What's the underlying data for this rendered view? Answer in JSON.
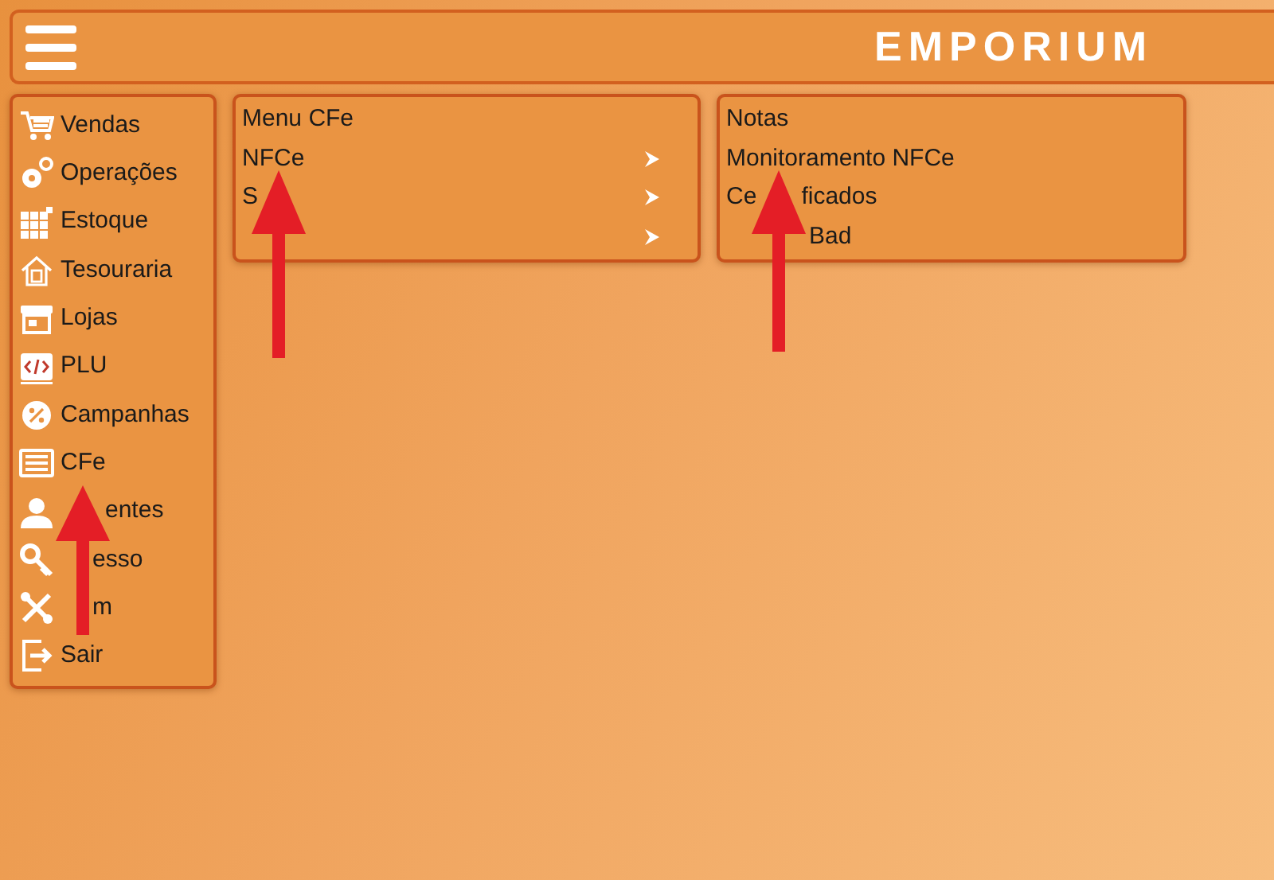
{
  "header": {
    "logo": "EMPORIUM"
  },
  "sidebar": {
    "items": [
      {
        "label": "Vendas",
        "kind": "cart"
      },
      {
        "label": "Operações",
        "kind": "gears"
      },
      {
        "label": "Estoque",
        "kind": "grid"
      },
      {
        "label": "Tesouraria",
        "kind": "house"
      },
      {
        "label": "Lojas",
        "kind": "store"
      },
      {
        "label": "PLU",
        "kind": "code"
      },
      {
        "label": "Campanhas",
        "kind": "percent"
      },
      {
        "label": "CFe",
        "kind": "list"
      },
      {
        "parts": [
          {
            "text": "entes",
            "kind": "wider"
          }
        ],
        "kind": "person"
      },
      {
        "parts": [
          {
            "text": "esso",
            "kind": "short"
          }
        ],
        "kind": "key"
      },
      {
        "parts": [
          {
            "text": "m",
            "kind": "short"
          }
        ],
        "kind": "tools"
      },
      {
        "label": "Sair",
        "kind": "exit"
      }
    ]
  },
  "submenus": [
    {
      "items": [
        {
          "label": "Menu CFe",
          "has_submenu": false
        },
        {
          "label": "NFCe",
          "has_submenu": true
        },
        {
          "parts": [
            {
              "text": "S",
              "kind": "plain"
            }
          ],
          "has_submenu": true
        },
        {
          "has_submenu": true
        }
      ]
    },
    {
      "items": [
        {
          "label": "Notas",
          "has_submenu": false
        },
        {
          "label": "Monitoramento NFCe",
          "has_submenu": false
        },
        {
          "parts": [
            {
              "text": "Ce",
              "kind": "plain"
            },
            {
              "text": "ficados",
              "kind": "wider"
            }
          ],
          "has_submenu": false
        },
        {
          "parts": [
            {
              "text": "Bad",
              "kind": "long"
            }
          ],
          "has_submenu": false
        }
      ]
    }
  ],
  "annotation_arrows": [
    {
      "kind": "up"
    },
    {
      "kind": "up"
    },
    {
      "kind": "up"
    }
  ]
}
